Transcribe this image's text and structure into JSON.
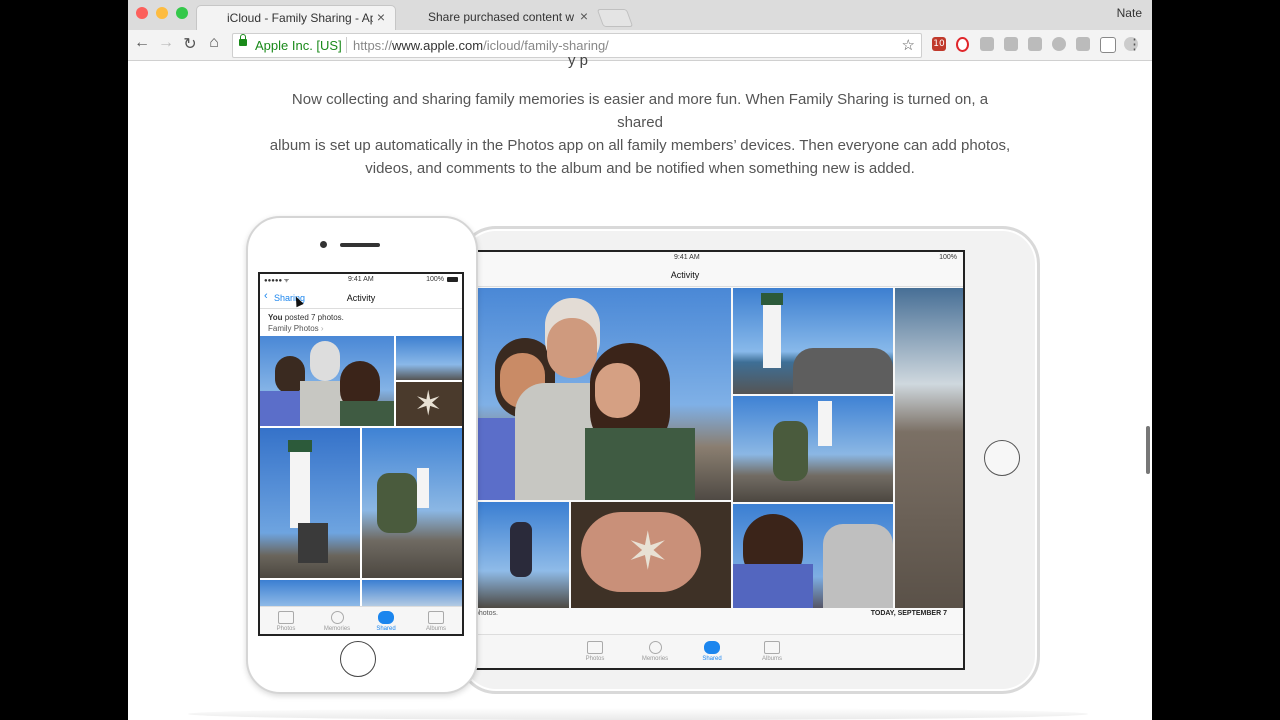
{
  "window": {
    "tabs": [
      {
        "title": "iCloud - Family Sharing - Apple",
        "icon": "apple-logo-icon",
        "active": true
      },
      {
        "title": "Share purchased content with",
        "icon": "apple-logo-icon",
        "active": false
      }
    ],
    "user": "Nate",
    "close_glyph": "×"
  },
  "toolbar": {
    "org": "Apple Inc. [US]",
    "url_scheme": "https://",
    "url_host": "www.apple.com",
    "url_path": "/icloud/family-sharing/",
    "calendar_badge": "10"
  },
  "page": {
    "cut_heading": "y p",
    "description_line1": "Now collecting and sharing family memories is easier and more fun. When Family Sharing is turned on, a shared",
    "description_line2": "album is set up automatically in the Photos app on all family members’ devices. Then everyone can add photos,",
    "description_line3": "videos, and comments to the album and be notified when something new is added."
  },
  "ipad": {
    "time": "9:41 AM",
    "battery": "100%",
    "title": "Activity",
    "footer_text": "photos.",
    "date": "TODAY, SEPTEMBER 7",
    "tabbar": [
      "Photos",
      "Memories",
      "Shared",
      "Albums"
    ],
    "active_tab": "Shared"
  },
  "iphone": {
    "carrier": "●●●●● ᯤ",
    "time": "9:41 AM",
    "battery": "100%",
    "back_label": "Sharing",
    "title": "Activity",
    "post_user": "You",
    "post_text": "posted 7 photos.",
    "album": "Family Photos",
    "tabbar": [
      "Photos",
      "Memories",
      "Shared",
      "Albums"
    ],
    "active_tab": "Shared"
  },
  "colors": {
    "link_blue": "#1c86ee",
    "secure_green": "#1a8a1a"
  }
}
